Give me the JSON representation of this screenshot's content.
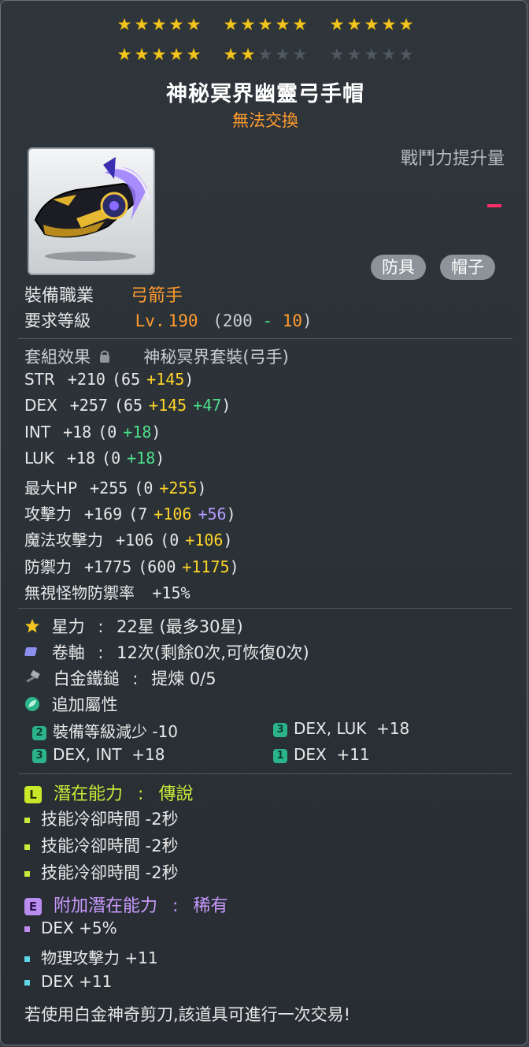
{
  "stars": {
    "rows": [
      [
        [
          1,
          1,
          1,
          1,
          1
        ],
        [
          1,
          1,
          1,
          1,
          1
        ],
        [
          1,
          1,
          1,
          1,
          1
        ]
      ],
      [
        [
          1,
          1,
          1,
          1,
          1
        ],
        [
          1,
          1,
          0,
          0,
          0
        ],
        [
          0,
          0,
          0,
          0,
          0
        ]
      ]
    ]
  },
  "item": {
    "name": "神秘冥界幽靈弓手帽",
    "trade_status": "無法交換",
    "combat_power_label": "戰鬥力提升量",
    "tags": [
      "防具",
      "帽子"
    ]
  },
  "requirements": {
    "job_label": "裝備職業",
    "job_value": "弓箭手",
    "level_label": "要求等級",
    "level_prefix": "Lv.",
    "level_value": "190",
    "level_base": "200",
    "level_minus": "10"
  },
  "set": {
    "label": "套組效果",
    "name": "神秘冥界套裝(弓手)"
  },
  "stats": [
    {
      "label": "STR",
      "total": "+210",
      "base": "65",
      "parts": [
        {
          "v": "+145",
          "c": "yellow"
        }
      ]
    },
    {
      "label": "DEX",
      "total": "+257",
      "base": "65",
      "parts": [
        {
          "v": "+145",
          "c": "yellow"
        },
        {
          "v": "+47",
          "c": "green"
        }
      ]
    },
    {
      "label": "INT",
      "total": "+18",
      "base": "0",
      "parts": [
        {
          "v": "+18",
          "c": "green"
        }
      ]
    },
    {
      "label": "LUK",
      "total": "+18",
      "base": "0",
      "parts": [
        {
          "v": "+18",
          "c": "green"
        }
      ]
    },
    {
      "label": "最大HP",
      "total": "+255",
      "base": "0",
      "parts": [
        {
          "v": "+255",
          "c": "yellow"
        }
      ]
    },
    {
      "label": "攻擊力",
      "total": "+169",
      "base": "7",
      "parts": [
        {
          "v": "+106",
          "c": "yellow"
        },
        {
          "v": "+56",
          "c": "purple"
        }
      ]
    },
    {
      "label": "魔法攻擊力",
      "total": "+106",
      "base": "0",
      "parts": [
        {
          "v": "+106",
          "c": "yellow"
        }
      ]
    },
    {
      "label": "防禦力",
      "total": "+1775",
      "base": "600",
      "parts": [
        {
          "v": "+1175",
          "c": "yellow"
        }
      ]
    }
  ],
  "ignore_def": {
    "label": "無視怪物防禦率",
    "value": "+15%"
  },
  "enhance": {
    "starforce_label": "星力",
    "starforce_value": "22星 (最多30星)",
    "scroll_label": "卷軸",
    "scroll_value": "12次(剩餘0次,可恢復0次)",
    "hammer_label": "白金鐵鎚",
    "hammer_value": "提煉 0/5",
    "flame_label": "追加屬性"
  },
  "flames": [
    {
      "tier": "2",
      "text": "裝備等級減少 -10"
    },
    {
      "tier": "3",
      "text": "DEX, LUK  +18"
    },
    {
      "tier": "3",
      "text": "DEX, INT  +18"
    },
    {
      "tier": "1",
      "text": "DEX  +11"
    }
  ],
  "potential": {
    "badge": "L",
    "label": "潛在能力",
    "grade": "傳說",
    "lines": [
      "技能冷卻時間 -2秒",
      "技能冷卻時間 -2秒",
      "技能冷卻時間 -2秒"
    ]
  },
  "additional": {
    "badge": "E",
    "label": "附加潛在能力",
    "grade": "稀有",
    "lines": [
      {
        "text": "DEX +5%",
        "color": "#c08cf0"
      },
      {
        "text": "物理攻擊力 +11",
        "color": "#5fd6e8"
      },
      {
        "text": "DEX +11",
        "color": "#5fd6e8"
      }
    ]
  },
  "footer": "若使用白金神奇剪刀,該道具可進行一次交易!",
  "colors": {
    "orange": "#ff9b2e",
    "yellow": "#ffd42a",
    "green": "#4ee08c",
    "purple": "#b59cff",
    "legendary": "#c6ec3a",
    "rare": "#c999ff",
    "combat": "#ff2e6a"
  }
}
